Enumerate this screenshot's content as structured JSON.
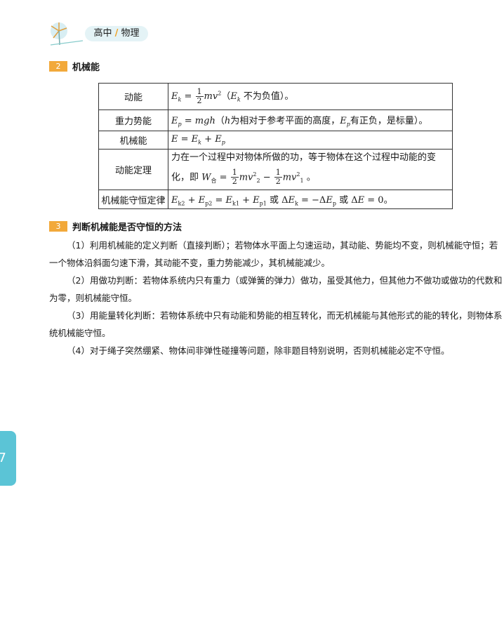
{
  "header": {
    "subject_left": "高中",
    "subject_sep": "/",
    "subject_right": "物理"
  },
  "section2": {
    "num": "2",
    "title": "机械能"
  },
  "table": {
    "rows": [
      {
        "key": "动能"
      },
      {
        "key": "重力势能"
      },
      {
        "key": "机械能"
      },
      {
        "key": "动能定理"
      },
      {
        "key": "机械能守恒定律"
      }
    ],
    "kinetic_note_pre": "（",
    "kinetic_note_post": "不为负值）。",
    "potential_note_pre": "（",
    "potential_note_mid": "为相对于参考平面的高度，",
    "potential_note_post": "有正负，是标量）。",
    "theorem_line1": "力在一个过程中对物体所做的功，等于物体在这个过程中动能的变",
    "theorem_line2_pre": "化，即",
    "theorem_line2_post": "。",
    "conservation_or1": "或",
    "conservation_or2": "或",
    "conservation_end": "。"
  },
  "section3": {
    "num": "3",
    "title": "判断机械能是否守恒的方法",
    "paragraphs": [
      "（1）利用机械能的定义判断（直接判断）；若物体水平面上匀速运动，其动能、势能均不变，则机械能守恒；若一个物体沿斜面匀速下滑，其动能不变，重力势能减少，其机械能减少。",
      "（2）用做功判断：若物体系统内只有重力（或弹簧的弹力）做功，虽受其他力，但其他力不做功或做功的代数和为零，则机械能守恒。",
      "（3）用能量转化判断：若物体系统中只有动能和势能的相互转化，而无机械能与其他形式的能的转化，则物体系统机械能守恒。",
      "（4）对于绳子突然绷紧、物体间非弹性碰撞等问题，除非题目特别说明，否则机械能必定不守恒。"
    ]
  },
  "page_number": "7",
  "colors": {
    "accent": "#f2a93b",
    "tab": "#5bc4d6",
    "pill": "#e4f3f6"
  }
}
